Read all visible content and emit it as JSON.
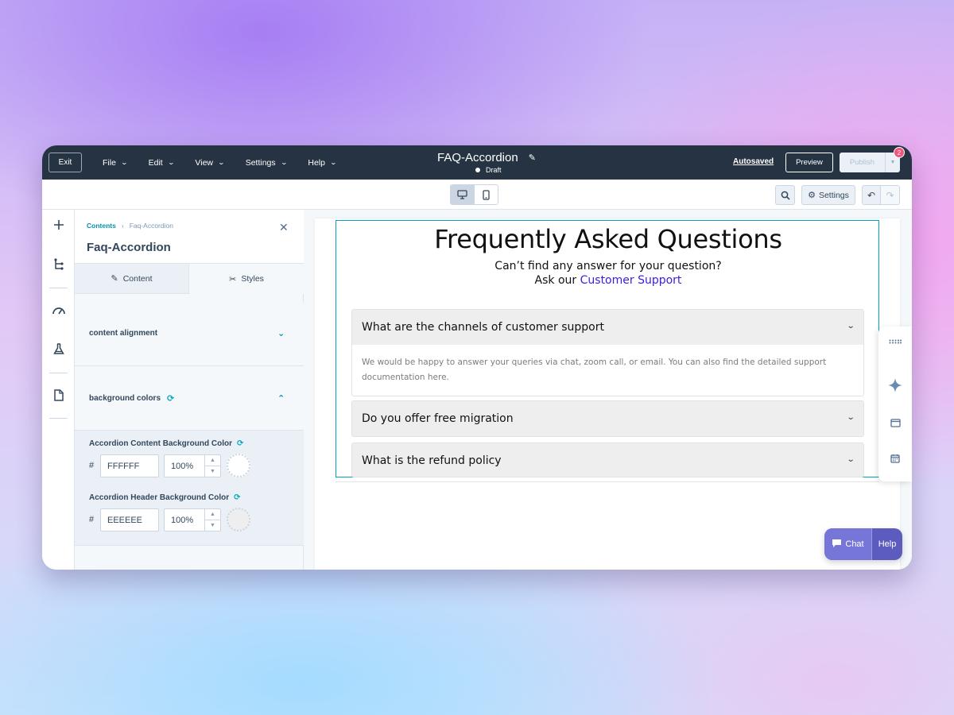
{
  "topbar": {
    "exit_label": "Exit",
    "menus": [
      "File",
      "Edit",
      "View",
      "Settings",
      "Help"
    ],
    "doc_title": "FAQ-Accordion",
    "status": "Draft",
    "autosaved": "Autosaved",
    "preview_label": "Preview",
    "publish_label": "Publish",
    "notification_count": "2"
  },
  "toolbar": {
    "settings_label": "Settings"
  },
  "panel": {
    "breadcrumb_root": "Contents",
    "breadcrumb_current": "Faq-Accordion",
    "title": "Faq-Accordion",
    "tab_content": "Content",
    "tab_styles": "Styles",
    "section_alignment": "content alignment",
    "section_bg": "background colors",
    "fields": [
      {
        "label": "Accordion Content Background Color",
        "hex": "FFFFFF",
        "opacity": "100%",
        "swatch": "#FFFFFF"
      },
      {
        "label": "Accordion Header Background Color",
        "hex": "EEEEEE",
        "opacity": "100%",
        "swatch": "#EEEEEE"
      }
    ]
  },
  "faq": {
    "title": "Frequently Asked Questions",
    "subtitle_line1": "Can’t find any answer for your question?",
    "subtitle_prefix": "Ask our ",
    "subtitle_link": "Customer Support",
    "items": [
      {
        "question": "What are the channels of customer support",
        "answer": "We would be happy to answer your queries via chat, zoom call, or email. You can also find the detailed support documentation here."
      },
      {
        "question": "Do you offer free migration"
      },
      {
        "question": "What is the refund policy"
      }
    ]
  },
  "chat": {
    "chat_label": "Chat",
    "help_label": "Help"
  },
  "colors": {
    "topbar": "#253342",
    "accent": "#0091ae",
    "link": "#3a1be6",
    "badge": "#f2547d"
  }
}
